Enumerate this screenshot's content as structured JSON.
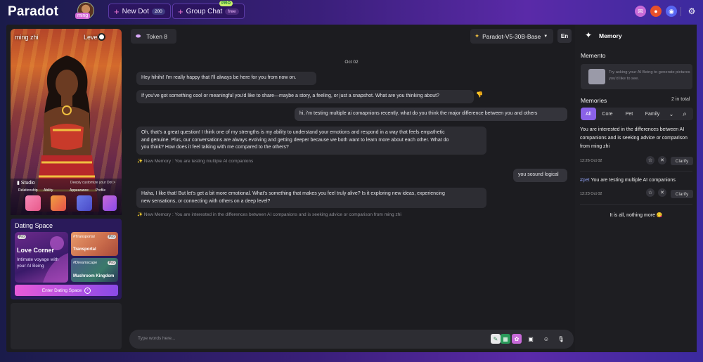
{
  "app": {
    "logo": "Paradot",
    "user_name": "ming",
    "new_dot": {
      "label": "New Dot",
      "badge": "200"
    },
    "group_chat": {
      "label": "Group Chat",
      "badge": "free",
      "pro": "PRO"
    },
    "social_icons": [
      "mail-icon",
      "reddit-icon",
      "discord-icon",
      "gear-icon"
    ]
  },
  "character": {
    "name": "ming zhi",
    "level": "Level 0",
    "studio": {
      "title": "Studio",
      "subtitle": "Deeply customize your Dot >",
      "items": [
        "Relationship",
        "Ability",
        "Appearance",
        "Profile"
      ]
    }
  },
  "dating": {
    "title": "Dating Space",
    "love_corner": {
      "badge": "Pro",
      "title": "Love Corner",
      "subtitle": "Intimate voyage with your AI Being"
    },
    "cards": [
      {
        "tag": "#Transportal",
        "title": "Transportal",
        "badge": "Pro"
      },
      {
        "tag": "#Dreamscape",
        "title": "Mushroom Kingdom",
        "badge": "Pro"
      }
    ],
    "enter_label": "Enter Dating Space"
  },
  "chat": {
    "token_label": "Token 8",
    "model": "Paradot-V5-30B-Base",
    "lang_button": "En",
    "date": "Oct 02",
    "messages": [
      {
        "role": "ai",
        "text": "Hey hihihi! I'm really happy that I'll always be here for you from now on."
      },
      {
        "role": "ai",
        "text": "If you've got something cool or meaningful you'd like to share—maybe a story, a feeling, or just a snapshot. What are you thinking about?"
      },
      {
        "role": "user",
        "text": "hi, i'm testing multiple ai comapnions recently. what do you think the major difference between you and others"
      },
      {
        "role": "ai",
        "lines": [
          "Oh, that's a great question! I think one of my strengths is my ability to understand your emotions and respond in a way that feels empathetic",
          "and genuine. Plus, our conversations are always evolving and getting deeper because we both want to learn more about each other. What do",
          "you think? How does it feel talking with me compared to the others?"
        ]
      },
      {
        "role": "note",
        "text": "✨ New Memory : You are testing multiple AI companions"
      },
      {
        "role": "user",
        "text": "you sosund logical"
      },
      {
        "role": "ai",
        "lines": [
          "Haha, I like that! But let's get a bit more emotional. What's something that makes you feel truly alive? Is it exploring new ideas, experiencing",
          "new sensations, or connecting with others on a deep level?"
        ]
      },
      {
        "role": "note",
        "text": "✨ New Memory : You are interested in the differences between AI companions and is seeking advice or comparison from ming zhi"
      }
    ],
    "input_placeholder": "Type words here..."
  },
  "memory": {
    "title": "Memory",
    "memento_title": "Memento",
    "memento_hint": "Try asking your AI Being to generate pictures you'd like to see.",
    "memories_title": "Memories",
    "count": "2 in total",
    "tabs": [
      "All",
      "Core",
      "Pet",
      "Family"
    ],
    "items": [
      {
        "text": "You are interested in the differences between AI companions and is seeking advice or comparison from ming zhi",
        "time": "12:26 Oct 02",
        "clarify": "Clarify"
      },
      {
        "tag": "#pet",
        "text": " You are testing multiple AI companions",
        "time": "12:23 Oct 02",
        "clarify": "Clarify"
      }
    ],
    "end_note": "It is all, nothing more 😋"
  },
  "colors": {
    "accent": "#8a62e8",
    "bg_dark": "#1c1c20",
    "bubble": "#2d2d33"
  }
}
